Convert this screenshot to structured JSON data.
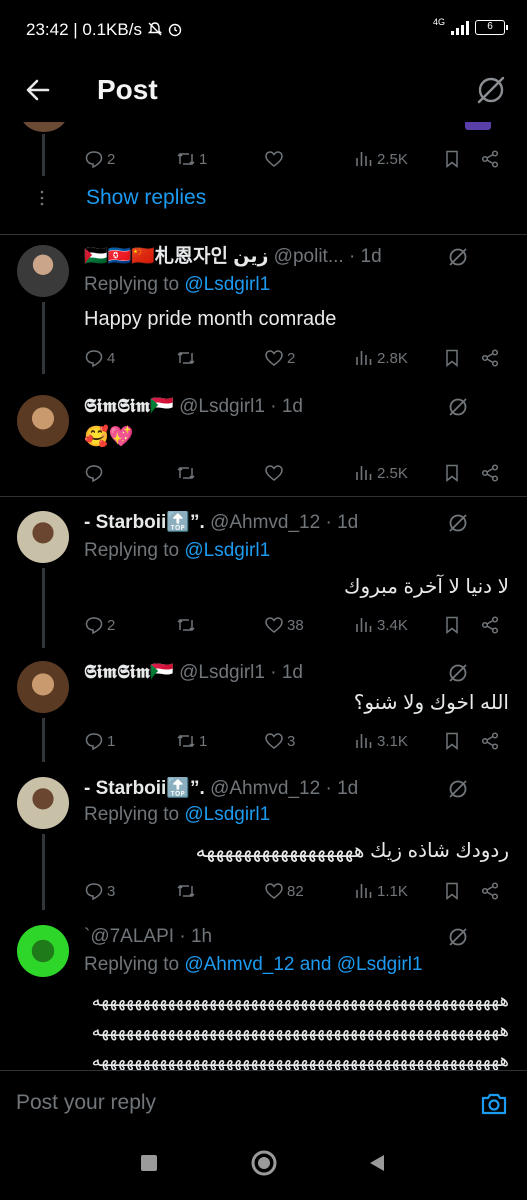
{
  "status": {
    "time": "23:42",
    "speed": "0.1KB/s",
    "network": "4G",
    "battery": "6"
  },
  "header": {
    "title": "Post"
  },
  "top_tweet": {
    "stats": {
      "replies": "2",
      "retweets": "1",
      "likes": "",
      "views": "2.5K"
    },
    "show_replies": "Show replies"
  },
  "tweets": [
    {
      "name": "🇵🇸🇰🇵🇨🇳札恩자인 زين",
      "handle": "@polit...",
      "time": "1d",
      "reply_prefix": "Replying to",
      "reply_to": "@Lsdgirl1",
      "text": "Happy pride month comrade",
      "stats": {
        "replies": "4",
        "retweets": "",
        "likes": "2",
        "views": "2.8K"
      }
    },
    {
      "name": "𝕾𝖎𝖒𝕾𝖎𝖒🇸🇩",
      "handle": "@Lsdgirl1",
      "time": "1d",
      "text": "🥰💖",
      "stats": {
        "replies": "",
        "retweets": "",
        "likes": "",
        "views": "2.5K"
      }
    },
    {
      "name": "- Starboii🔝”.",
      "handle": "@Ahmvd_12",
      "time": "1d",
      "reply_prefix": "Replying to",
      "reply_to": "@Lsdgirl1",
      "text": "لا دنيا لا آخرة مبروك",
      "stats": {
        "replies": "2",
        "retweets": "",
        "likes": "38",
        "views": "3.4K"
      }
    },
    {
      "name": "𝕾𝖎𝖒𝕾𝖎𝖒🇸🇩",
      "handle": "@Lsdgirl1",
      "time": "1d",
      "text": "الله اخوك ولا شنو؟",
      "stats": {
        "replies": "1",
        "retweets": "1",
        "likes": "3",
        "views": "3.1K"
      }
    },
    {
      "name": "- Starboii🔝”.",
      "handle": "@Ahmvd_12",
      "time": "1d",
      "reply_prefix": "Replying to",
      "reply_to": "@Lsdgirl1",
      "text": "ردودك شاذه زيك هههههههههههههههههه",
      "stats": {
        "replies": "3",
        "retweets": "",
        "likes": "82",
        "views": "1.1K"
      }
    },
    {
      "name": "",
      "handle": "`@7ALAPI",
      "time": "1h",
      "reply_prefix": "Replying to",
      "reply_to": "@Ahmvd_12 and @Lsdgirl1",
      "text_lines": [
        "هههههههههههههههههههههههههههههههههههههههههههههههههه",
        "هههههههههههههههههههههههههههههههههههههههههههههههههه",
        "هههههههههههههههههههههههههههههههههههههههههههههههههه"
      ]
    }
  ],
  "reply_bar": {
    "placeholder": "Post your reply"
  },
  "icons": {
    "back": "arrow-left-icon",
    "grok": "grok-icon",
    "reply": "reply-icon",
    "retweet": "retweet-icon",
    "like": "heart-icon",
    "views": "views-icon",
    "bookmark": "bookmark-icon",
    "share": "share-icon",
    "camera": "camera-icon"
  },
  "colors": {
    "background": "#000000",
    "accent": "#1d9bf0",
    "muted": "#71767b",
    "text": "#e7e9ea"
  }
}
